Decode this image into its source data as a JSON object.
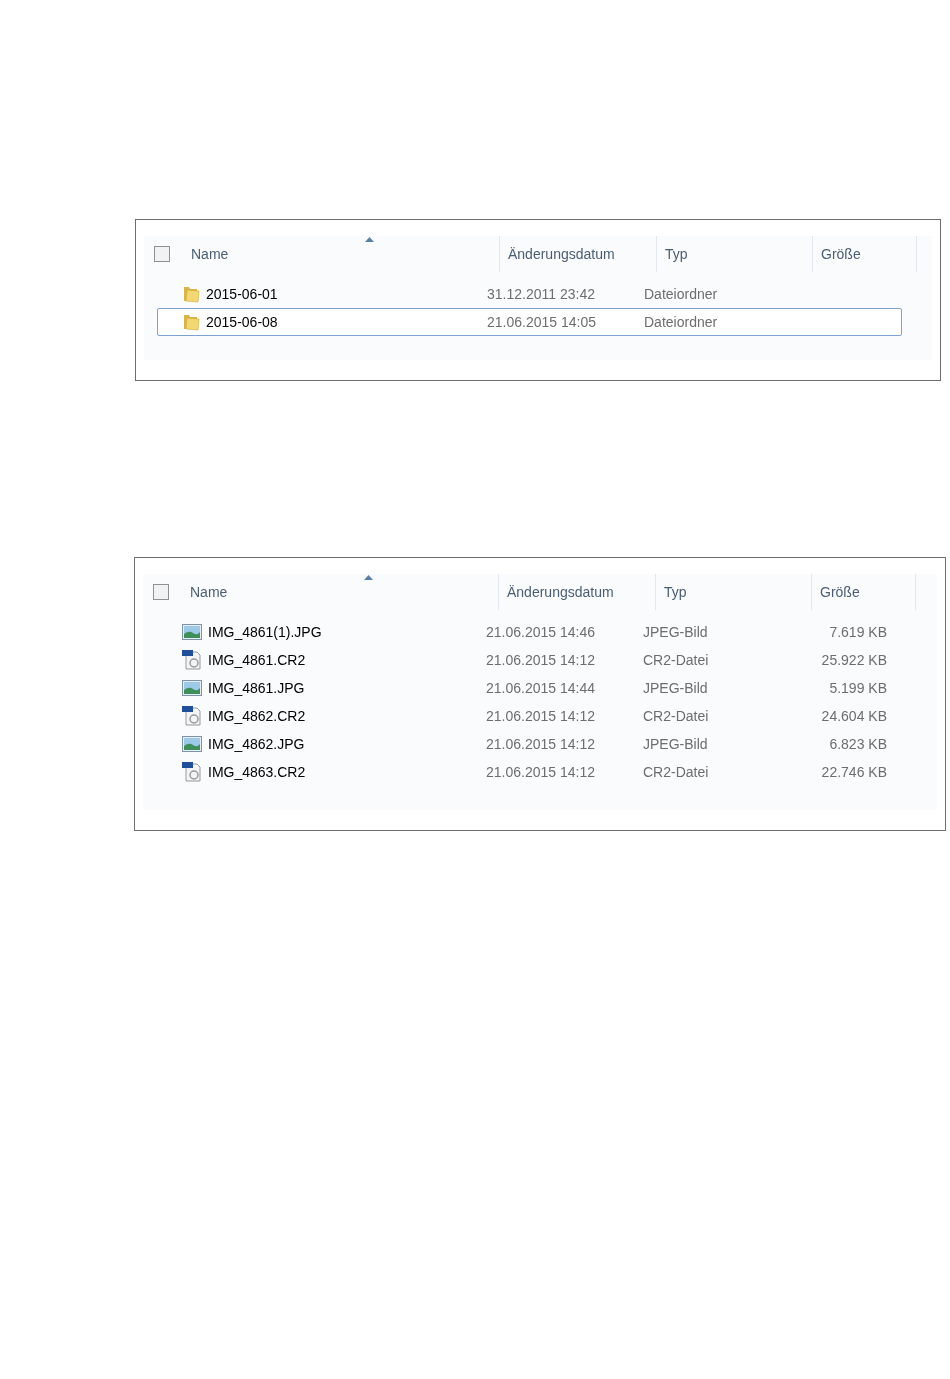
{
  "panels": [
    {
      "select_all": {
        "checked": false
      },
      "columns": [
        {
          "label": "Name",
          "sorted": true
        },
        {
          "label": "Änderungsdatum",
          "sorted": false
        },
        {
          "label": "Typ",
          "sorted": false
        },
        {
          "label": "Größe",
          "sorted": false
        }
      ],
      "rows": [
        {
          "kind": "folder",
          "name": "2015-06-01",
          "date": "31.12.2011 23:42",
          "type": "Dateiordner",
          "selected": false
        },
        {
          "kind": "folder",
          "name": "2015-06-08",
          "date": "21.06.2015 14:05",
          "type": "Dateiordner",
          "selected": true
        }
      ]
    },
    {
      "select_all": {
        "checked": false
      },
      "columns": [
        {
          "label": "Name",
          "sorted": true
        },
        {
          "label": "Änderungsdatum",
          "sorted": false
        },
        {
          "label": "Typ",
          "sorted": false
        },
        {
          "label": "Größe",
          "sorted": false
        }
      ],
      "rows": [
        {
          "kind": "image",
          "name": "IMG_4861(1).JPG",
          "date": "21.06.2015 14:46",
          "type": "JPEG-Bild",
          "size": "7.619 KB",
          "selected": false
        },
        {
          "kind": "raw",
          "name": "IMG_4861.CR2",
          "date": "21.06.2015 14:12",
          "type": "CR2-Datei",
          "size": "25.922 KB",
          "selected": false
        },
        {
          "kind": "image",
          "name": "IMG_4861.JPG",
          "date": "21.06.2015 14:44",
          "type": "JPEG-Bild",
          "size": "5.199 KB",
          "selected": false
        },
        {
          "kind": "raw",
          "name": "IMG_4862.CR2",
          "date": "21.06.2015 14:12",
          "type": "CR2-Datei",
          "size": "24.604 KB",
          "selected": false
        },
        {
          "kind": "image",
          "name": "IMG_4862.JPG",
          "date": "21.06.2015 14:12",
          "type": "JPEG-Bild",
          "size": "6.823 KB",
          "selected": false
        },
        {
          "kind": "raw",
          "name": "IMG_4863.CR2",
          "date": "21.06.2015 14:12",
          "type": "CR2-Datei",
          "size": "22.746 KB",
          "selected": false
        }
      ]
    }
  ]
}
